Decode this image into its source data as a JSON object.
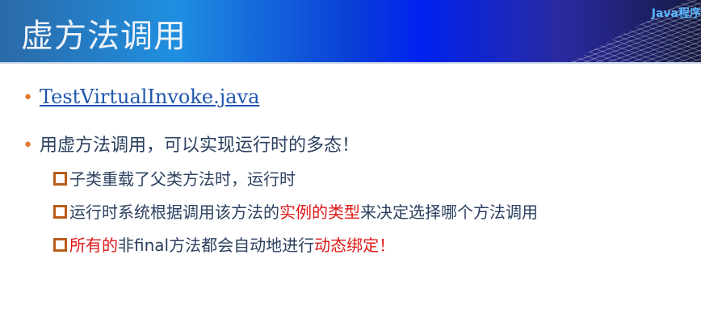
{
  "header": {
    "title": "虚方法调用",
    "brand": "Java程序"
  },
  "bullets": [
    {
      "link": "TestVirtualInvoke.java"
    },
    {
      "text": "用虚方法调用，可以实现运行时的多态！"
    }
  ],
  "sub": [
    {
      "parts": [
        "子类重载了父类方法时，运行时"
      ]
    },
    {
      "parts": [
        "运行时系统根据调用该方法的",
        "实例的类型",
        "来决定选择哪个方法调用"
      ]
    },
    {
      "parts": [
        "所有的",
        "非final方法都会自动地进行",
        "动态绑定",
        "！"
      ]
    }
  ]
}
